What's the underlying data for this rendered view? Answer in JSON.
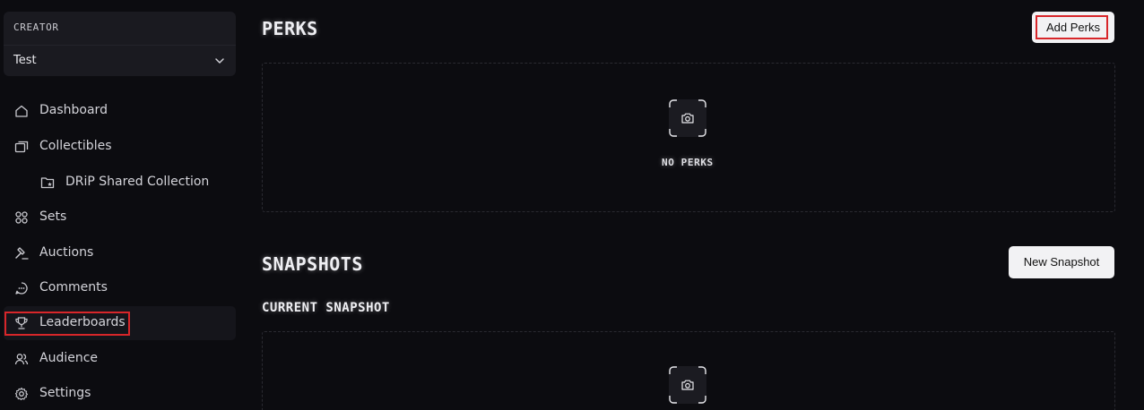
{
  "sidebar": {
    "creator_label": "CREATOR",
    "creator_value": "Test",
    "items": [
      {
        "label": "Dashboard",
        "icon": "home-icon"
      },
      {
        "label": "Collectibles",
        "icon": "collectibles-icon"
      },
      {
        "label": "DRiP Shared Collection",
        "icon": "folder-star-icon"
      },
      {
        "label": "Sets",
        "icon": "sets-icon"
      },
      {
        "label": "Auctions",
        "icon": "gavel-icon"
      },
      {
        "label": "Comments",
        "icon": "comment-icon"
      },
      {
        "label": "Leaderboards",
        "icon": "trophy-icon"
      },
      {
        "label": "Audience",
        "icon": "audience-icon"
      },
      {
        "label": "Settings",
        "icon": "gear-icon"
      }
    ],
    "active_item": "Leaderboards"
  },
  "perks": {
    "title": "PERKS",
    "add_button": "Add Perks",
    "empty_text": "NO PERKS"
  },
  "snapshots": {
    "title": "SNAPSHOTS",
    "new_button": "New Snapshot",
    "current_title": "CURRENT SNAPSHOT"
  },
  "colors": {
    "background": "#0c0c10",
    "sidebar_panel": "#1a1a20",
    "button_bg": "#f2f2f4",
    "highlight": "#d8262a"
  }
}
